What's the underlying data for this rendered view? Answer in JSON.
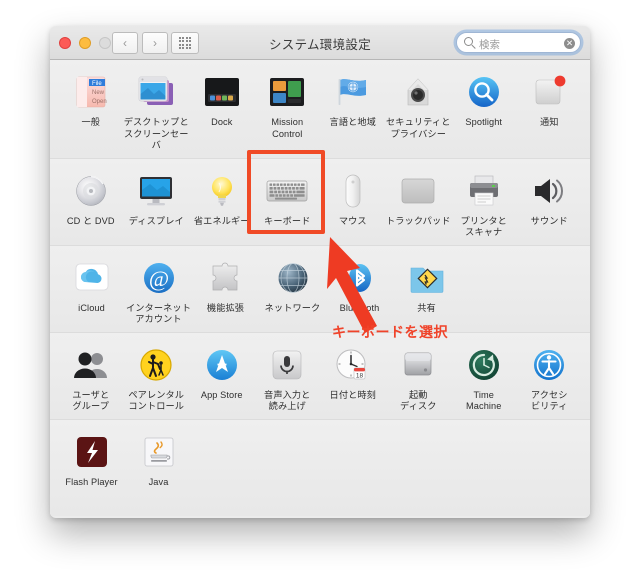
{
  "window": {
    "title": "システム環境設定",
    "traffic_lights": [
      "close-button",
      "minimize-button",
      "zoom-button"
    ],
    "nav": {
      "back_label": "‹",
      "forward_label": "›"
    },
    "grid_button_name": "show-all-button"
  },
  "search": {
    "placeholder": "検索",
    "value": "",
    "clear_label": "✕"
  },
  "annotation": {
    "text": "キーボードを選択",
    "color": "#f0432a",
    "highlight_color": "#f04a26",
    "target": "キーボード"
  },
  "rows": [
    {
      "panes": [
        {
          "label": "一般",
          "icon": "general-icon"
        },
        {
          "label": "デスクトップと\nスクリーンセーバ",
          "icon": "desktop-screensaver-icon"
        },
        {
          "label": "Dock",
          "icon": "dock-icon"
        },
        {
          "label": "Mission\nControl",
          "icon": "mission-control-icon"
        },
        {
          "label": "言語と地域",
          "icon": "language-region-icon"
        },
        {
          "label": "セキュリティと\nプライバシー",
          "icon": "security-privacy-icon"
        },
        {
          "label": "Spotlight",
          "icon": "spotlight-icon"
        },
        {
          "label": "通知",
          "icon": "notifications-icon"
        }
      ]
    },
    {
      "panes": [
        {
          "label": "CD と DVD",
          "icon": "cd-dvd-icon"
        },
        {
          "label": "ディスプレイ",
          "icon": "displays-icon"
        },
        {
          "label": "省エネルギー",
          "icon": "energy-saver-icon"
        },
        {
          "label": "キーボード",
          "icon": "keyboard-icon"
        },
        {
          "label": "マウス",
          "icon": "mouse-icon"
        },
        {
          "label": "トラックパッド",
          "icon": "trackpad-icon"
        },
        {
          "label": "プリンタと\nスキャナ",
          "icon": "printers-scanners-icon"
        },
        {
          "label": "サウンド",
          "icon": "sound-icon"
        }
      ]
    },
    {
      "panes": [
        {
          "label": "iCloud",
          "icon": "icloud-icon"
        },
        {
          "label": "インターネット\nアカウント",
          "icon": "internet-accounts-icon"
        },
        {
          "label": "機能拡張",
          "icon": "extensions-icon"
        },
        {
          "label": "ネットワーク",
          "icon": "network-icon"
        },
        {
          "label": "Bluetooth",
          "icon": "bluetooth-icon"
        },
        {
          "label": "共有",
          "icon": "sharing-icon"
        }
      ]
    },
    {
      "panes": [
        {
          "label": "ユーザと\nグループ",
          "icon": "users-groups-icon"
        },
        {
          "label": "ペアレンタル\nコントロール",
          "icon": "parental-controls-icon"
        },
        {
          "label": "App Store",
          "icon": "app-store-icon"
        },
        {
          "label": "音声入力と\n読み上げ",
          "icon": "dictation-speech-icon"
        },
        {
          "label": "日付と時刻",
          "icon": "date-time-icon"
        },
        {
          "label": "起動\nディスク",
          "icon": "startup-disk-icon"
        },
        {
          "label": "Time\nMachine",
          "icon": "time-machine-icon"
        },
        {
          "label": "アクセシ\nビリティ",
          "icon": "accessibility-icon"
        }
      ]
    },
    {
      "panes": [
        {
          "label": "Flash Player",
          "icon": "flash-player-icon"
        },
        {
          "label": "Java",
          "icon": "java-icon"
        }
      ]
    }
  ]
}
